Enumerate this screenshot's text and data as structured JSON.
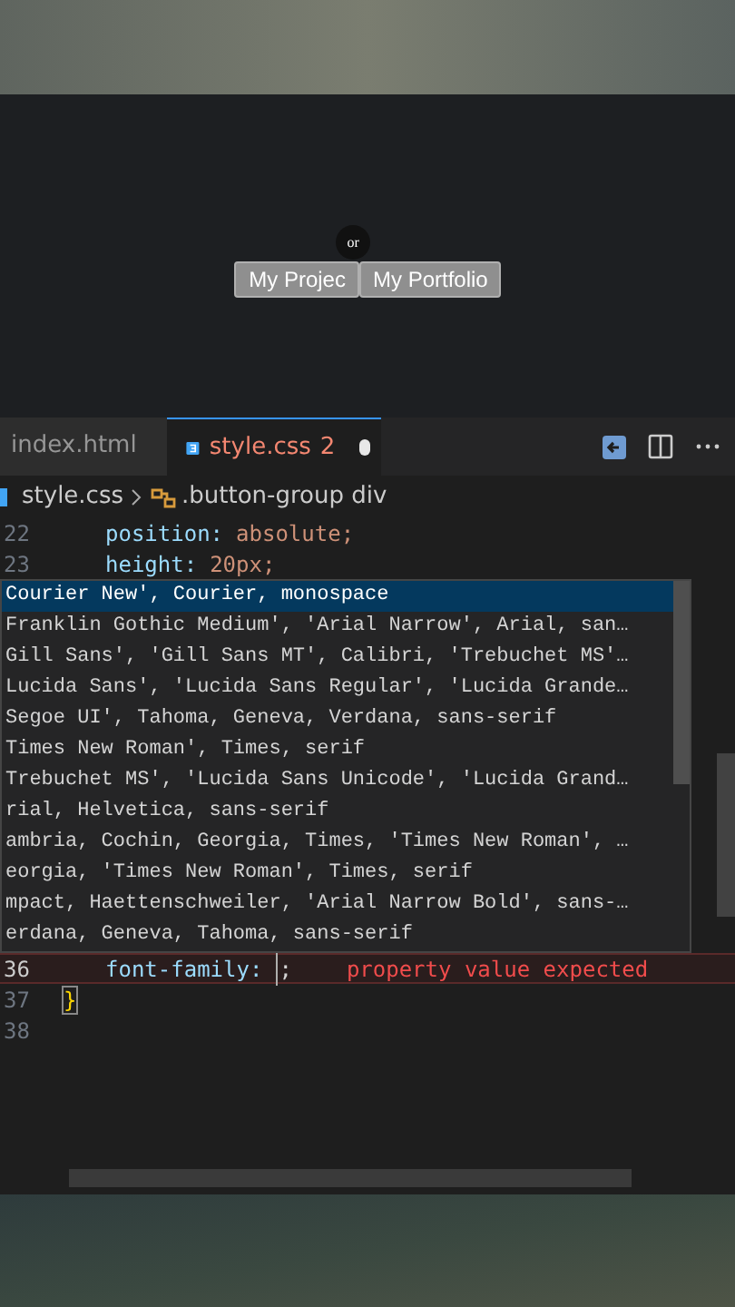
{
  "preview": {
    "buttons": [
      {
        "label": "My Projec"
      },
      {
        "label": "My Portfolio"
      }
    ],
    "badge": "or"
  },
  "tabs": [
    {
      "label": "index.html",
      "selected": false
    },
    {
      "label": "style.css",
      "selected": true,
      "problems": "2",
      "modified": true
    }
  ],
  "breadcrumb": [
    "style.css",
    ".button-group div"
  ],
  "lines_before": [
    {
      "number": "22",
      "property": "position:",
      "value": "absolute;"
    },
    {
      "number": "23",
      "property": "height:",
      "value": "20px;"
    }
  ],
  "suggestions": [
    {
      "label": "Courier New', Courier, monospace",
      "selected": true
    },
    {
      "label": "Franklin Gothic Medium', 'Arial Narrow', Arial, san…",
      "selected": false
    },
    {
      "label": "Gill Sans', 'Gill Sans MT', Calibri, 'Trebuchet MS'…",
      "selected": false
    },
    {
      "label": "Lucida Sans', 'Lucida Sans Regular', 'Lucida Grande…",
      "selected": false
    },
    {
      "label": "Segoe UI', Tahoma, Geneva, Verdana, sans-serif",
      "selected": false
    },
    {
      "label": "Times New Roman', Times, serif",
      "selected": false
    },
    {
      "label": "Trebuchet MS', 'Lucida Sans Unicode', 'Lucida Grand…",
      "selected": false
    },
    {
      "label": "rial, Helvetica, sans-serif",
      "selected": false
    },
    {
      "label": "ambria, Cochin, Georgia, Times, 'Times New Roman', …",
      "selected": false
    },
    {
      "label": "eorgia, 'Times New Roman', Times, serif",
      "selected": false
    },
    {
      "label": "mpact, Haettenschweiler, 'Arial Narrow Bold', sans-…",
      "selected": false
    },
    {
      "label": "erdana, Geneva, Tahoma, sans-serif",
      "selected": false
    }
  ],
  "lines_after": [
    {
      "number": "36",
      "property": "font-family:",
      "value": ";",
      "error": "property value expected"
    },
    {
      "number": "37",
      "bracket": "}"
    },
    {
      "number": "38"
    }
  ]
}
